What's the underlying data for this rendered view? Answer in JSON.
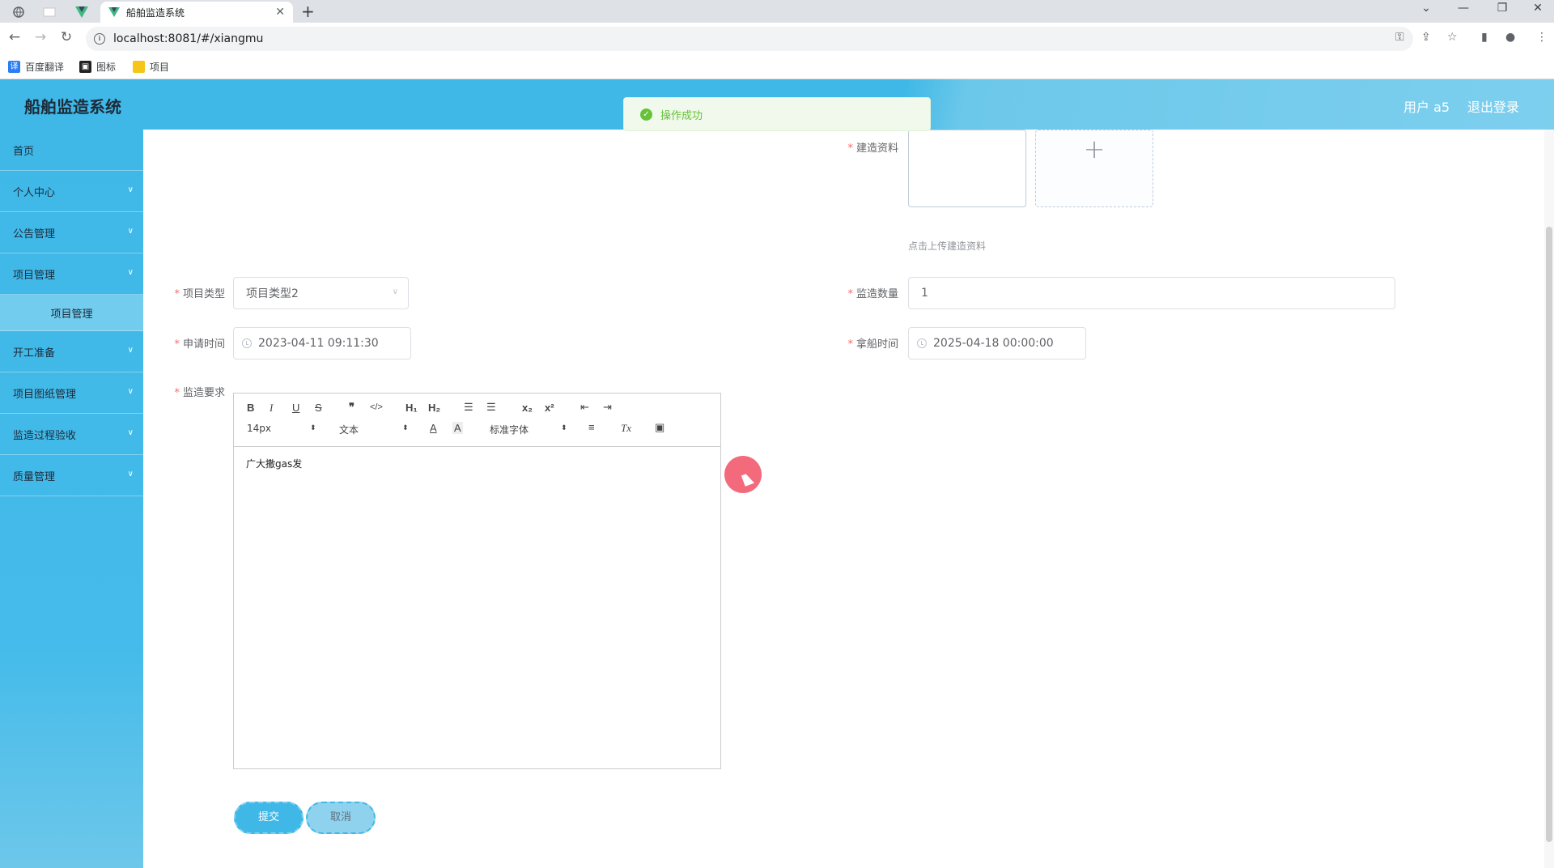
{
  "browser": {
    "tab_title": "船舶监造系统",
    "url": "localhost:8081/#/xiangmu",
    "bookmarks": [
      "百度翻译",
      "图标",
      "项目"
    ]
  },
  "header": {
    "title": "船舶监造系统",
    "user": "用户 a5",
    "logout": "退出登录",
    "color": "#3fb8e7"
  },
  "sidebar": {
    "items": [
      {
        "label": "首页"
      },
      {
        "label": "个人中心"
      },
      {
        "label": "公告管理"
      },
      {
        "label": "项目管理"
      },
      {
        "label": "项目管理"
      },
      {
        "label": "开工准备"
      },
      {
        "label": "项目图纸管理"
      },
      {
        "label": "监造过程验收"
      },
      {
        "label": "质量管理"
      }
    ]
  },
  "toast": {
    "message": "操作成功"
  },
  "form": {
    "upload_label": "建造资料",
    "upload_tip": "点击上传建造资料",
    "type_label": "项目类型",
    "type_value": "项目类型2",
    "qty_label": "监造数量",
    "qty_value": "1",
    "apply_label": "申请时间",
    "apply_value": "2023-04-11 09:11:30",
    "ship_label": "拿船时间",
    "ship_value": "2025-04-18 00:00:00",
    "req_label": "监造要求",
    "req_content": "广大撒gas发",
    "required_mark": "*"
  },
  "editor_toolbar": {
    "bold": "B",
    "italic": "I",
    "underline": "U",
    "strike": "S",
    "quote": "❞",
    "code": "</>",
    "h1": "H₁",
    "h2": "H₂",
    "olist": "☰",
    "ulist": "☰",
    "sub": "x₂",
    "sup": "x²",
    "outdent": "⇤",
    "indent": "⇥",
    "size": "14px",
    "header": "文本",
    "font": "标准字体",
    "color": "A",
    "bg": "A",
    "align": "≡",
    "clean": "Tx",
    "image": "▣"
  },
  "buttons": {
    "submit": "提交",
    "cancel": "取消"
  }
}
